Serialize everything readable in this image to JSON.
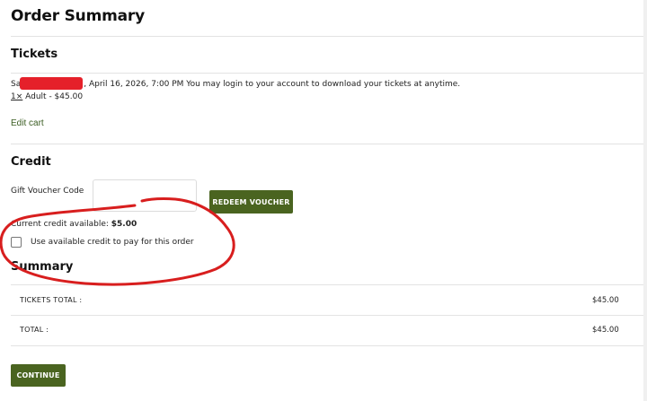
{
  "header": {
    "title": "Order Summary"
  },
  "tickets": {
    "heading": "Tickets",
    "event_prefix": "Sa",
    "event_text": ", April 16, 2026, 7:00 PM You may login to your account to download your tickets at anytime.",
    "quantity_link": "1×",
    "quantity_text": " Adult - $45.00",
    "edit_cart_label": "Edit cart"
  },
  "credit": {
    "heading": "Credit",
    "voucher_label": "Gift Voucher Code",
    "voucher_value": "",
    "redeem_label": "REDEEM VOUCHER",
    "available_prefix": "Current credit available: ",
    "available_amount": "$5.00",
    "use_credit_label": "Use available credit to pay for this order",
    "use_credit_checked": false
  },
  "summary": {
    "heading": "Summary",
    "rows": [
      {
        "label": "TICKETS TOTAL :",
        "value": "$45.00"
      },
      {
        "label": "TOTAL :",
        "value": "$45.00"
      }
    ]
  },
  "actions": {
    "continue_label": "CONTINUE"
  },
  "colors": {
    "accent": "#4a6420",
    "annotation": "#d81e1e",
    "redaction": "#e5202a"
  }
}
